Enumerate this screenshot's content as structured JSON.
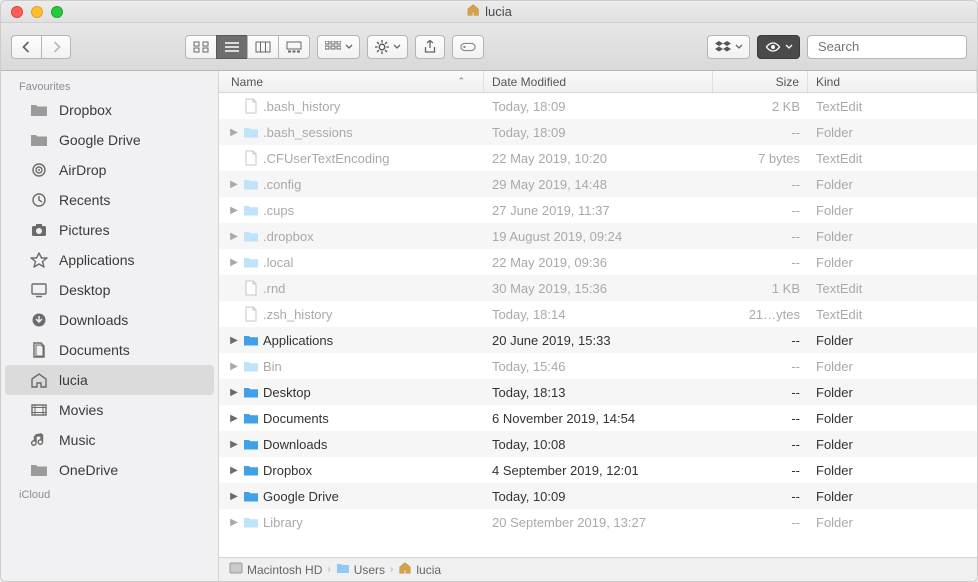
{
  "title": "lucia",
  "toolbar": {
    "search_placeholder": "Search"
  },
  "sidebar": {
    "sections": [
      {
        "title": "Favourites",
        "items": [
          {
            "icon": "folder-gray",
            "label": "Dropbox"
          },
          {
            "icon": "folder-gray",
            "label": "Google Drive"
          },
          {
            "icon": "airdrop",
            "label": "AirDrop"
          },
          {
            "icon": "clock",
            "label": "Recents"
          },
          {
            "icon": "camera",
            "label": "Pictures"
          },
          {
            "icon": "apps",
            "label": "Applications"
          },
          {
            "icon": "desktop",
            "label": "Desktop"
          },
          {
            "icon": "download",
            "label": "Downloads"
          },
          {
            "icon": "documents",
            "label": "Documents"
          },
          {
            "icon": "home",
            "label": "lucia",
            "selected": true
          },
          {
            "icon": "movies",
            "label": "Movies"
          },
          {
            "icon": "music",
            "label": "Music"
          },
          {
            "icon": "folder-gray",
            "label": "OneDrive"
          }
        ]
      },
      {
        "title": "iCloud",
        "items": []
      }
    ]
  },
  "columns": {
    "name": "Name",
    "date": "Date Modified",
    "size": "Size",
    "kind": "Kind"
  },
  "files": [
    {
      "name": ".bash_history",
      "date": "Today, 18:09",
      "size": "2 KB",
      "kind": "TextEdit",
      "type": "file",
      "hidden": true
    },
    {
      "name": ".bash_sessions",
      "date": "Today, 18:09",
      "size": "--",
      "kind": "Folder",
      "type": "folder",
      "hidden": true
    },
    {
      "name": ".CFUserTextEncoding",
      "date": "22 May 2019, 10:20",
      "size": "7 bytes",
      "kind": "TextEdit",
      "type": "file",
      "hidden": true
    },
    {
      "name": ".config",
      "date": "29 May 2019, 14:48",
      "size": "--",
      "kind": "Folder",
      "type": "folder",
      "hidden": true
    },
    {
      "name": ".cups",
      "date": "27 June 2019, 11:37",
      "size": "--",
      "kind": "Folder",
      "type": "folder",
      "hidden": true
    },
    {
      "name": ".dropbox",
      "date": "19 August 2019, 09:24",
      "size": "--",
      "kind": "Folder",
      "type": "folder",
      "hidden": true
    },
    {
      "name": ".local",
      "date": "22 May 2019, 09:36",
      "size": "--",
      "kind": "Folder",
      "type": "folder",
      "hidden": true
    },
    {
      "name": ".rnd",
      "date": "30 May 2019, 15:36",
      "size": "1 KB",
      "kind": "TextEdit",
      "type": "file",
      "hidden": true
    },
    {
      "name": ".zsh_history",
      "date": "Today, 18:14",
      "size": "21…ytes",
      "kind": "TextEdit",
      "type": "file",
      "hidden": true
    },
    {
      "name": "Applications",
      "date": "20 June 2019, 15:33",
      "size": "--",
      "kind": "Folder",
      "type": "folder-sys",
      "hidden": false
    },
    {
      "name": "Bin",
      "date": "Today, 15:46",
      "size": "--",
      "kind": "Folder",
      "type": "folder",
      "hidden": true
    },
    {
      "name": "Desktop",
      "date": "Today, 18:13",
      "size": "--",
      "kind": "Folder",
      "type": "folder-sys",
      "hidden": false
    },
    {
      "name": "Documents",
      "date": "6 November 2019, 14:54",
      "size": "--",
      "kind": "Folder",
      "type": "folder-sys",
      "hidden": false
    },
    {
      "name": "Downloads",
      "date": "Today, 10:08",
      "size": "--",
      "kind": "Folder",
      "type": "folder-sys",
      "hidden": false
    },
    {
      "name": "Dropbox",
      "date": "4 September 2019, 12:01",
      "size": "--",
      "kind": "Folder",
      "type": "folder-sys",
      "hidden": false
    },
    {
      "name": "Google Drive",
      "date": "Today, 10:09",
      "size": "--",
      "kind": "Folder",
      "type": "folder-sys",
      "hidden": false
    },
    {
      "name": "Library",
      "date": "20 September 2019, 13:27",
      "size": "--",
      "kind": "Folder",
      "type": "folder",
      "hidden": true
    }
  ],
  "path": [
    {
      "icon": "disk",
      "label": "Macintosh HD"
    },
    {
      "icon": "folder",
      "label": "Users"
    },
    {
      "icon": "home",
      "label": "lucia"
    }
  ]
}
